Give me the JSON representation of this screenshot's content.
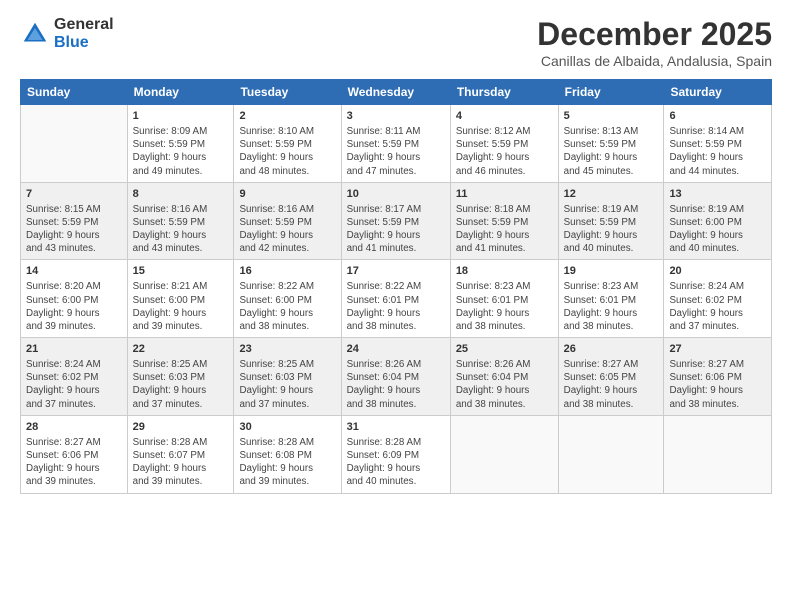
{
  "logo": {
    "general": "General",
    "blue": "Blue"
  },
  "title": "December 2025",
  "subtitle": "Canillas de Albaida, Andalusia, Spain",
  "header_days": [
    "Sunday",
    "Monday",
    "Tuesday",
    "Wednesday",
    "Thursday",
    "Friday",
    "Saturday"
  ],
  "weeks": [
    [
      {
        "day": "",
        "info": ""
      },
      {
        "day": "1",
        "info": "Sunrise: 8:09 AM\nSunset: 5:59 PM\nDaylight: 9 hours\nand 49 minutes."
      },
      {
        "day": "2",
        "info": "Sunrise: 8:10 AM\nSunset: 5:59 PM\nDaylight: 9 hours\nand 48 minutes."
      },
      {
        "day": "3",
        "info": "Sunrise: 8:11 AM\nSunset: 5:59 PM\nDaylight: 9 hours\nand 47 minutes."
      },
      {
        "day": "4",
        "info": "Sunrise: 8:12 AM\nSunset: 5:59 PM\nDaylight: 9 hours\nand 46 minutes."
      },
      {
        "day": "5",
        "info": "Sunrise: 8:13 AM\nSunset: 5:59 PM\nDaylight: 9 hours\nand 45 minutes."
      },
      {
        "day": "6",
        "info": "Sunrise: 8:14 AM\nSunset: 5:59 PM\nDaylight: 9 hours\nand 44 minutes."
      }
    ],
    [
      {
        "day": "7",
        "info": "Sunrise: 8:15 AM\nSunset: 5:59 PM\nDaylight: 9 hours\nand 43 minutes."
      },
      {
        "day": "8",
        "info": "Sunrise: 8:16 AM\nSunset: 5:59 PM\nDaylight: 9 hours\nand 43 minutes."
      },
      {
        "day": "9",
        "info": "Sunrise: 8:16 AM\nSunset: 5:59 PM\nDaylight: 9 hours\nand 42 minutes."
      },
      {
        "day": "10",
        "info": "Sunrise: 8:17 AM\nSunset: 5:59 PM\nDaylight: 9 hours\nand 41 minutes."
      },
      {
        "day": "11",
        "info": "Sunrise: 8:18 AM\nSunset: 5:59 PM\nDaylight: 9 hours\nand 41 minutes."
      },
      {
        "day": "12",
        "info": "Sunrise: 8:19 AM\nSunset: 5:59 PM\nDaylight: 9 hours\nand 40 minutes."
      },
      {
        "day": "13",
        "info": "Sunrise: 8:19 AM\nSunset: 6:00 PM\nDaylight: 9 hours\nand 40 minutes."
      }
    ],
    [
      {
        "day": "14",
        "info": "Sunrise: 8:20 AM\nSunset: 6:00 PM\nDaylight: 9 hours\nand 39 minutes."
      },
      {
        "day": "15",
        "info": "Sunrise: 8:21 AM\nSunset: 6:00 PM\nDaylight: 9 hours\nand 39 minutes."
      },
      {
        "day": "16",
        "info": "Sunrise: 8:22 AM\nSunset: 6:00 PM\nDaylight: 9 hours\nand 38 minutes."
      },
      {
        "day": "17",
        "info": "Sunrise: 8:22 AM\nSunset: 6:01 PM\nDaylight: 9 hours\nand 38 minutes."
      },
      {
        "day": "18",
        "info": "Sunrise: 8:23 AM\nSunset: 6:01 PM\nDaylight: 9 hours\nand 38 minutes."
      },
      {
        "day": "19",
        "info": "Sunrise: 8:23 AM\nSunset: 6:01 PM\nDaylight: 9 hours\nand 38 minutes."
      },
      {
        "day": "20",
        "info": "Sunrise: 8:24 AM\nSunset: 6:02 PM\nDaylight: 9 hours\nand 37 minutes."
      }
    ],
    [
      {
        "day": "21",
        "info": "Sunrise: 8:24 AM\nSunset: 6:02 PM\nDaylight: 9 hours\nand 37 minutes."
      },
      {
        "day": "22",
        "info": "Sunrise: 8:25 AM\nSunset: 6:03 PM\nDaylight: 9 hours\nand 37 minutes."
      },
      {
        "day": "23",
        "info": "Sunrise: 8:25 AM\nSunset: 6:03 PM\nDaylight: 9 hours\nand 37 minutes."
      },
      {
        "day": "24",
        "info": "Sunrise: 8:26 AM\nSunset: 6:04 PM\nDaylight: 9 hours\nand 38 minutes."
      },
      {
        "day": "25",
        "info": "Sunrise: 8:26 AM\nSunset: 6:04 PM\nDaylight: 9 hours\nand 38 minutes."
      },
      {
        "day": "26",
        "info": "Sunrise: 8:27 AM\nSunset: 6:05 PM\nDaylight: 9 hours\nand 38 minutes."
      },
      {
        "day": "27",
        "info": "Sunrise: 8:27 AM\nSunset: 6:06 PM\nDaylight: 9 hours\nand 38 minutes."
      }
    ],
    [
      {
        "day": "28",
        "info": "Sunrise: 8:27 AM\nSunset: 6:06 PM\nDaylight: 9 hours\nand 39 minutes."
      },
      {
        "day": "29",
        "info": "Sunrise: 8:28 AM\nSunset: 6:07 PM\nDaylight: 9 hours\nand 39 minutes."
      },
      {
        "day": "30",
        "info": "Sunrise: 8:28 AM\nSunset: 6:08 PM\nDaylight: 9 hours\nand 39 minutes."
      },
      {
        "day": "31",
        "info": "Sunrise: 8:28 AM\nSunset: 6:09 PM\nDaylight: 9 hours\nand 40 minutes."
      },
      {
        "day": "",
        "info": ""
      },
      {
        "day": "",
        "info": ""
      },
      {
        "day": "",
        "info": ""
      }
    ]
  ]
}
